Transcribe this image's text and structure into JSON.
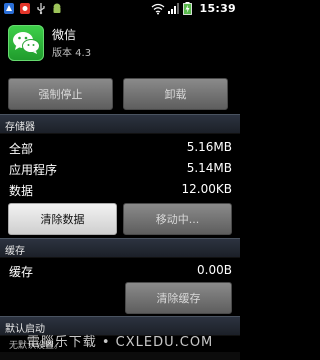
{
  "status_bar": {
    "time": "15:39"
  },
  "app": {
    "name": "微信",
    "version": "版本 4.3"
  },
  "actions": {
    "force_stop": "强制停止",
    "uninstall": "卸载"
  },
  "storage": {
    "header": "存储器",
    "rows": [
      {
        "label": "全部",
        "value": "5.16MB"
      },
      {
        "label": "应用程序",
        "value": "5.14MB"
      },
      {
        "label": "数据",
        "value": "12.00KB"
      }
    ],
    "clear_data": "清除数据",
    "move": "移动中..."
  },
  "cache": {
    "header": "缓存",
    "label": "缓存",
    "value": "0.00B",
    "clear_cache": "清除缓存"
  },
  "default_launch": {
    "header": "默认启动",
    "description": "无默认设置。"
  },
  "watermark": "電腦乐下载 • CXLEDU.COM"
}
